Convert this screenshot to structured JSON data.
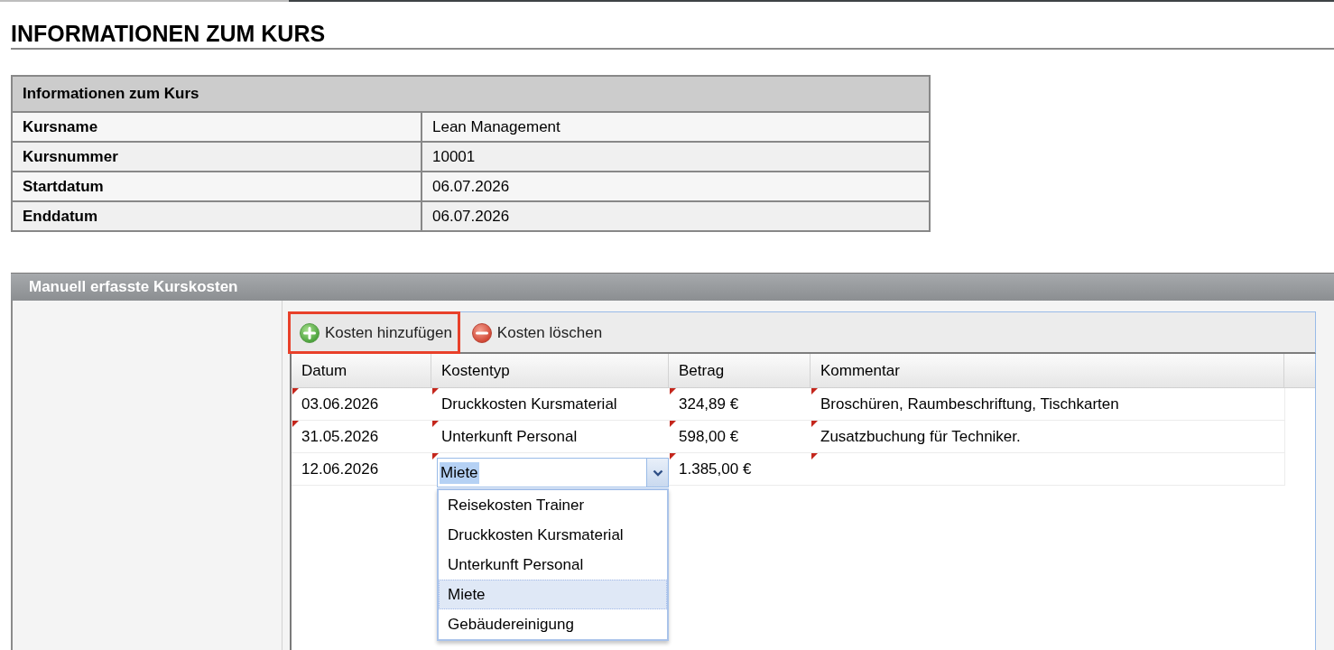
{
  "page": {
    "title": "INFORMATIONEN ZUM KURS"
  },
  "info_table": {
    "title": "Informationen zum Kurs",
    "rows": [
      {
        "label": "Kursname",
        "value": "Lean Management"
      },
      {
        "label": "Kursnummer",
        "value": "10001"
      },
      {
        "label": "Startdatum",
        "value": "06.07.2026"
      },
      {
        "label": "Enddatum",
        "value": "06.07.2026"
      }
    ]
  },
  "cost_panel": {
    "title": "Manuell erfasste Kurskosten",
    "toolbar": [
      {
        "kind": "add",
        "label": "Kosten hinzufügen",
        "highlighted": true
      },
      {
        "kind": "delete",
        "label": "Kosten löschen",
        "highlighted": false
      }
    ],
    "grid": {
      "columns": [
        "Datum",
        "Kostentyp",
        "Betrag",
        "Kommentar"
      ],
      "rows": [
        {
          "cells": [
            {
              "kind": "text",
              "text": "03.06.2026",
              "dirty": true
            },
            {
              "kind": "text",
              "text": "Druckkosten Kursmaterial",
              "dirty": true
            },
            {
              "kind": "text",
              "text": "324,89 €",
              "dirty": true
            },
            {
              "kind": "text",
              "text": "Broschüren, Raumbeschriftung, Tischkarten",
              "dirty": true
            }
          ]
        },
        {
          "cells": [
            {
              "kind": "text",
              "text": "31.05.2026",
              "dirty": true
            },
            {
              "kind": "text",
              "text": "Unterkunft Personal",
              "dirty": true
            },
            {
              "kind": "text",
              "text": "598,00 €",
              "dirty": true
            },
            {
              "kind": "text",
              "text": "Zusatzbuchung für Techniker.",
              "dirty": true
            }
          ]
        },
        {
          "cells": [
            {
              "kind": "text",
              "text": "12.06.2026",
              "dirty": false
            },
            {
              "kind": "combo",
              "value": "Miete",
              "dirty": true,
              "text_selected": true,
              "expanded": true,
              "options": [
                {
                  "label": "Reisekosten Trainer",
                  "selected": false
                },
                {
                  "label": "Druckkosten Kursmaterial",
                  "selected": false
                },
                {
                  "label": "Unterkunft Personal",
                  "selected": false
                },
                {
                  "label": "Miete",
                  "selected": true
                },
                {
                  "label": "Gebäudereinigung",
                  "selected": false
                }
              ]
            },
            {
              "kind": "text",
              "text": "1.385,00 €",
              "dirty": true
            },
            {
              "kind": "text",
              "dirty": true
            }
          ]
        }
      ]
    }
  }
}
